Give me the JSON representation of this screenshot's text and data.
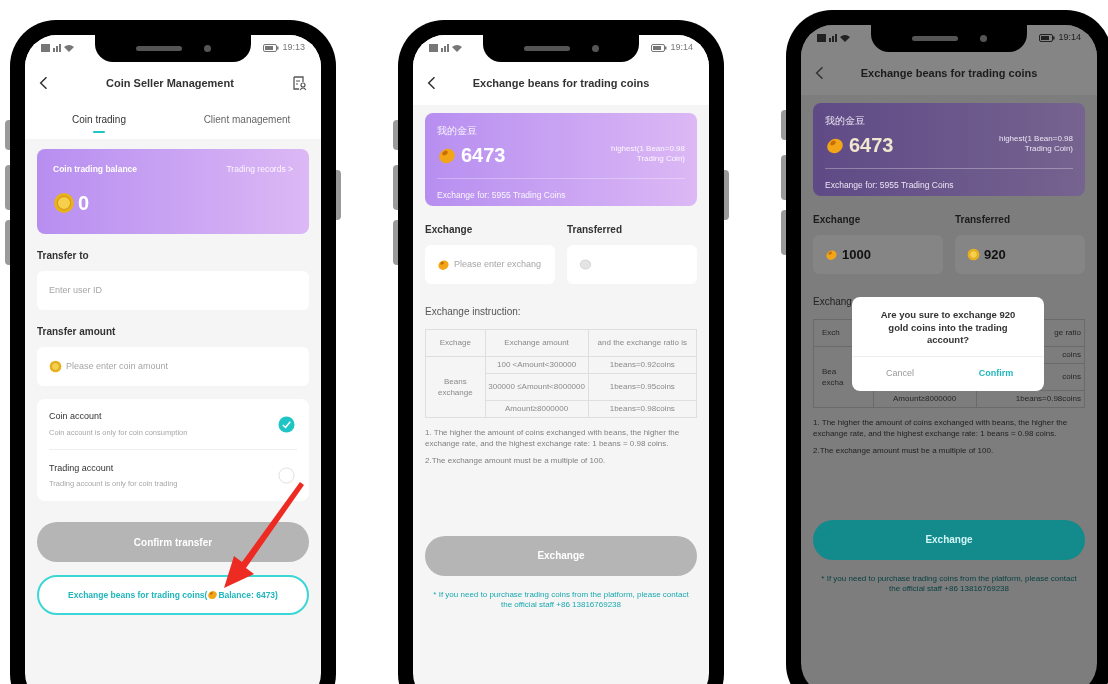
{
  "phones": [
    {
      "kind": "transfer",
      "status_time": "19:13",
      "title": "Coin Seller Management",
      "tabs": [
        {
          "label": "Coin trading",
          "selected": true
        },
        {
          "label": "Client management",
          "selected": false
        }
      ],
      "balance_card": {
        "label": "Coin trading balance",
        "link": "Trading records >",
        "amount": "0"
      },
      "transfer_to": {
        "label": "Transfer to",
        "placeholder": "Enter user ID"
      },
      "transfer_amount": {
        "label": "Transfer amount",
        "placeholder": "Please enter coin amount"
      },
      "accounts": [
        {
          "name": "Coin account",
          "description": "Coin account is only for coin consumption",
          "checked": true
        },
        {
          "name": "Trading account",
          "description": "Trading account is only for coin trading",
          "checked": false
        }
      ],
      "confirm_button": {
        "label": "Confirm transfer",
        "disabled": true
      },
      "exchange_button": {
        "text_before": "Exchange beans for trading coins(",
        "text_after": "Balance: 6473)"
      }
    },
    {
      "kind": "exchange",
      "status_time": "19:14",
      "title": "Exchange beans for trading coins",
      "bean_card": {
        "label": "我的金豆",
        "amount": "6473",
        "rate_note": "highest(1 Bean=0.98 Trading Coin)",
        "exchange_for": "Exchange for: 5955 Trading Coins"
      },
      "exchange_field": {
        "label": "Exchange",
        "placeholder": "Please enter exchang"
      },
      "transferred_field": {
        "label": "Transferred"
      },
      "instruction_label": "Exchange instruction:",
      "table": {
        "column_1": "Exchage",
        "column_2": "Exchange amount",
        "column_3": "and the exchange ratio is",
        "group": [
          "Beans",
          "exchange"
        ],
        "rows": [
          {
            "column_2": "100 <Amount<300000",
            "column_3": "1beans=0.92coins"
          },
          {
            "column_2": "300000 ≤Amount<8000000",
            "column_3": "1beans=0.95coins"
          },
          {
            "column_2": "Amount≥8000000",
            "column_3": "1beans=0.98coins"
          }
        ]
      },
      "notes": [
        "1. The higher the amount of coins exchanged with beans, the higher the exchange rate, and the highest exchange rate: 1 beans = 0.98 coins.",
        "2.The exchange amount must be a multiple of 100."
      ],
      "exchange_button": {
        "label": "Exchange",
        "disabled": true
      },
      "footer_note": "* If you need to purchase trading coins from the platform, please contact the official staff +86 13816769238"
    },
    {
      "kind": "exchange",
      "status_time": "19:14",
      "title": "Exchange beans for trading coins",
      "bean_card": {
        "label": "我的金豆",
        "amount": "6473",
        "rate_note": "highest(1 Bean=0.98 Trading Coin)",
        "exchange_for": "Exchange for: 5955 Trading Coins"
      },
      "exchange_field": {
        "label": "Exchange",
        "value": "1000"
      },
      "transferred_field": {
        "label": "Transferred",
        "value": "920"
      },
      "instruction_label": "Exchang",
      "table": {
        "column_1": "Exch",
        "column_3": "ge ratio",
        "group": [
          "Bea",
          "excha"
        ],
        "rows": [
          {
            "column_3": "coins"
          },
          {
            "column_3": "coins"
          },
          {
            "column_2": "Amount≥8000000",
            "column_3": "1beans=0.98coins"
          }
        ]
      },
      "notes": [
        "1. The higher the amount of coins exchanged with beans, the higher the exchange rate, and the highest exchange rate: 1 beans = 0.98 coins.",
        "2.The exchange amount must be a multiple of 100."
      ],
      "exchange_button": {
        "label": "Exchange",
        "disabled": false
      },
      "footer_note": "* If you need to purchase trading coins from the platform, please contact the official staff +86 13816769238",
      "dialog": {
        "message": "Are you sure to exchange 920 gold coins into the trading account?",
        "cancel": "Cancel",
        "confirm": "Confirm"
      }
    }
  ]
}
